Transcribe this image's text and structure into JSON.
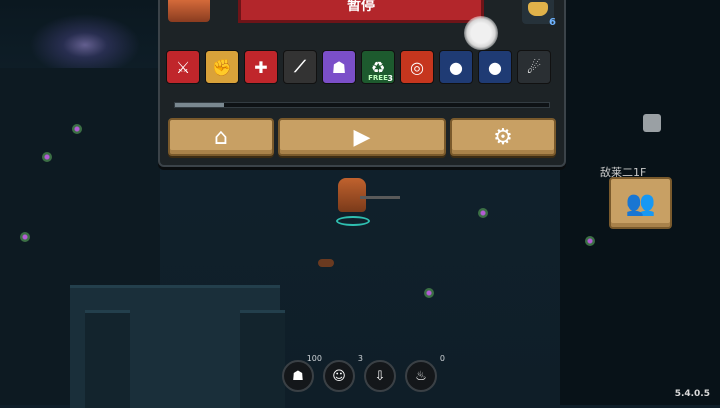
{
  "pause_panel": {
    "title": "暂停",
    "pet_count": "6",
    "progress": 0.13,
    "buffs": [
      {
        "icon": "sword-icon",
        "bg": "#c0262b",
        "glyph": "⚔",
        "sub": "",
        "num": ""
      },
      {
        "icon": "fist-icon",
        "bg": "#d9a23a",
        "glyph": "✊",
        "sub": "",
        "num": ""
      },
      {
        "icon": "health-cross-icon",
        "bg": "#c0262b",
        "glyph": "✚",
        "sub": "",
        "num": ""
      },
      {
        "icon": "slash-icon",
        "bg": "#333",
        "glyph": "⟋",
        "sub": "",
        "num": ""
      },
      {
        "icon": "ghost-icon",
        "bg": "#7b4fc9",
        "glyph": "☗",
        "sub": "",
        "num": ""
      },
      {
        "icon": "recycle-icon",
        "bg": "#1d5a2e",
        "glyph": "♻",
        "sub": "FREE",
        "num": "3"
      },
      {
        "icon": "fire-ring-icon",
        "bg": "#c6361e",
        "glyph": "◎",
        "sub": "",
        "num": ""
      },
      {
        "icon": "energy-orb-icon",
        "bg": "#1f3b74",
        "glyph": "●",
        "sub": "",
        "num": ""
      },
      {
        "icon": "frost-orb-icon",
        "bg": "#1f3b74",
        "glyph": "●",
        "sub": "",
        "num": ""
      },
      {
        "icon": "meteor-icon",
        "bg": "#2a2f33",
        "glyph": "☄",
        "sub": "",
        "num": ""
      }
    ],
    "buttons": [
      {
        "name": "home-button",
        "icon": "home-icon",
        "glyph": "⌂"
      },
      {
        "name": "resume-button",
        "icon": "play-icon",
        "glyph": "▶"
      },
      {
        "name": "settings-button",
        "icon": "gear-icon",
        "glyph": "⚙"
      }
    ]
  },
  "side": {
    "label": "敌莱二1F",
    "lobby_icon": "multiplayer-icon"
  },
  "hotbar": [
    {
      "icon": "ghost-skill-icon",
      "count": "100",
      "glyph": "☗"
    },
    {
      "icon": "character-swap-icon",
      "count": "3",
      "glyph": "☺"
    },
    {
      "icon": "pickup-arrow-icon",
      "count": "",
      "glyph": "⇩"
    },
    {
      "icon": "potion-icon",
      "count": "0",
      "glyph": "♨"
    }
  ],
  "version": "5.4.0.5"
}
